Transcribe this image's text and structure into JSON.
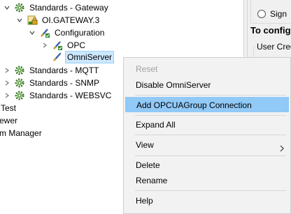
{
  "tree": {
    "items": [
      {
        "label": "Standards - Gateway"
      },
      {
        "label": "OI.GATEWAY.3"
      },
      {
        "label": "Configuration"
      },
      {
        "label": "OPC"
      },
      {
        "label": "OmniServer"
      },
      {
        "label": "Standards - MQTT"
      },
      {
        "label": "Standards - SNMP"
      },
      {
        "label": "Standards - WEBSVC"
      },
      {
        "label": "Test"
      },
      {
        "label": "ewer"
      },
      {
        "label": "m Manager"
      }
    ]
  },
  "right_panel": {
    "section_title": "To config",
    "group_label": "User Crede",
    "radio_label": "Sign"
  },
  "context_menu": {
    "items": [
      {
        "label": "Reset",
        "enabled": false
      },
      {
        "label": "Disable OmniServer",
        "enabled": true
      },
      {
        "label": "Add OPCUAGroup Connection",
        "enabled": true,
        "highlighted": true
      },
      {
        "label": "Expand All",
        "enabled": true
      },
      {
        "label": "View",
        "enabled": true,
        "has_submenu": true
      },
      {
        "label": "Delete",
        "enabled": true
      },
      {
        "label": "Rename",
        "enabled": true
      },
      {
        "label": "Help",
        "enabled": true
      }
    ]
  },
  "colors": {
    "menu_highlight": "#91c9f7",
    "tree_selection": "#cce8ff",
    "disabled_text": "#a0a0a0"
  }
}
